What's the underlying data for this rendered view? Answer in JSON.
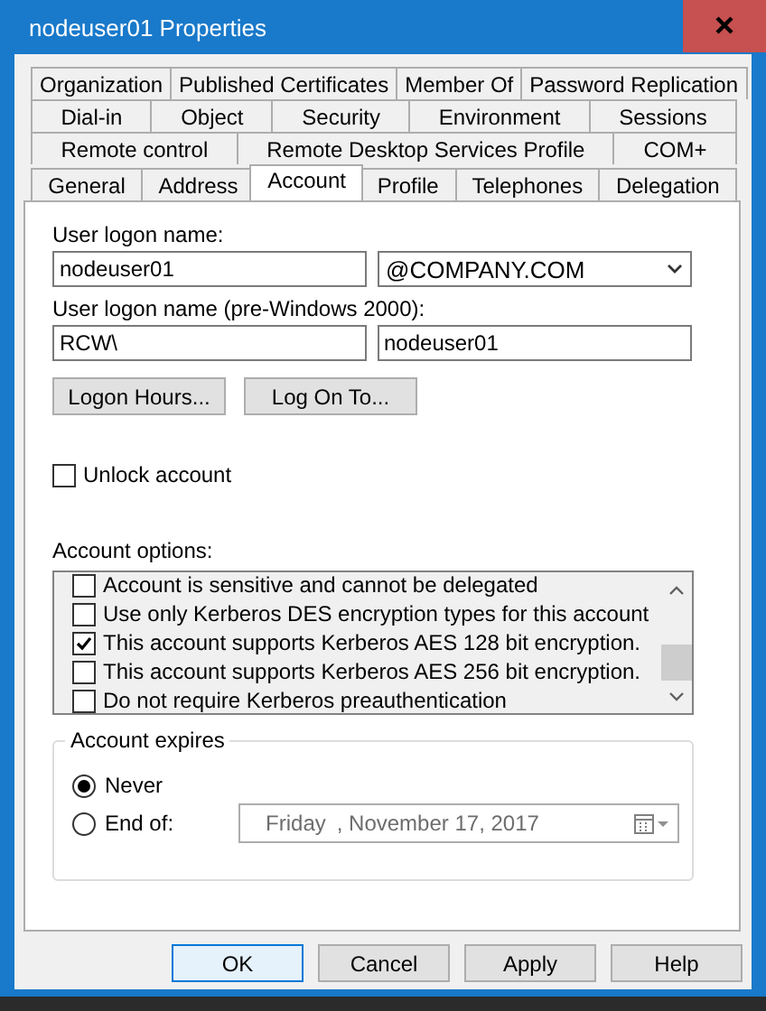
{
  "window": {
    "title": "nodeuser01 Properties"
  },
  "tab_rows": [
    {
      "tabs": [
        {
          "label": "Organization",
          "selected": false
        },
        {
          "label": "Published Certificates",
          "selected": false
        },
        {
          "label": "Member Of",
          "selected": false
        },
        {
          "label": "Password Replication",
          "selected": false
        }
      ]
    },
    {
      "tabs": [
        {
          "label": "Dial-in",
          "selected": false
        },
        {
          "label": "Object",
          "selected": false
        },
        {
          "label": "Security",
          "selected": false
        },
        {
          "label": "Environment",
          "selected": false
        },
        {
          "label": "Sessions",
          "selected": false
        }
      ]
    },
    {
      "tabs": [
        {
          "label": "Remote control",
          "selected": false
        },
        {
          "label": "Remote Desktop Services Profile",
          "selected": false
        },
        {
          "label": "COM+",
          "selected": false
        }
      ]
    },
    {
      "tabs": [
        {
          "label": "General",
          "selected": false
        },
        {
          "label": "Address",
          "selected": false
        },
        {
          "label": "Account",
          "selected": true
        },
        {
          "label": "Profile",
          "selected": false
        },
        {
          "label": "Telephones",
          "selected": false
        },
        {
          "label": "Delegation",
          "selected": false
        }
      ]
    }
  ],
  "account": {
    "logon_name": {
      "label": "User logon name:",
      "value": "nodeuser01",
      "domain": "@COMPANY.COM"
    },
    "pre2000": {
      "label": "User logon name (pre-Windows 2000):",
      "domain": "RCW\\",
      "value": "nodeuser01"
    },
    "buttons": [
      "Logon Hours...",
      "Log On To..."
    ],
    "unlock": {
      "label": "Unlock account",
      "checked": false
    },
    "options_label": "Account options:",
    "options": [
      {
        "label": "Account is sensitive and cannot be delegated",
        "checked": false
      },
      {
        "label": "Use only Kerberos DES encryption types for this account",
        "checked": false
      },
      {
        "label": "This account supports Kerberos AES 128 bit encryption.",
        "checked": true
      },
      {
        "label": "This account supports Kerberos AES 256 bit encryption.",
        "checked": false
      },
      {
        "label": "Do not require Kerberos preauthentication",
        "checked": false
      }
    ],
    "expires": {
      "title": "Account expires",
      "choices": [
        {
          "label": "Never",
          "selected": true
        },
        {
          "label": "End of:",
          "selected": false
        }
      ],
      "date": {
        "day": "Friday",
        "rest": ", November 17, 2017",
        "disabled": true
      }
    }
  },
  "buttons": [
    {
      "label": "OK",
      "default": true
    },
    {
      "label": "Cancel",
      "default": false
    },
    {
      "label": "Apply",
      "default": false
    },
    {
      "label": "Help",
      "default": false
    }
  ]
}
